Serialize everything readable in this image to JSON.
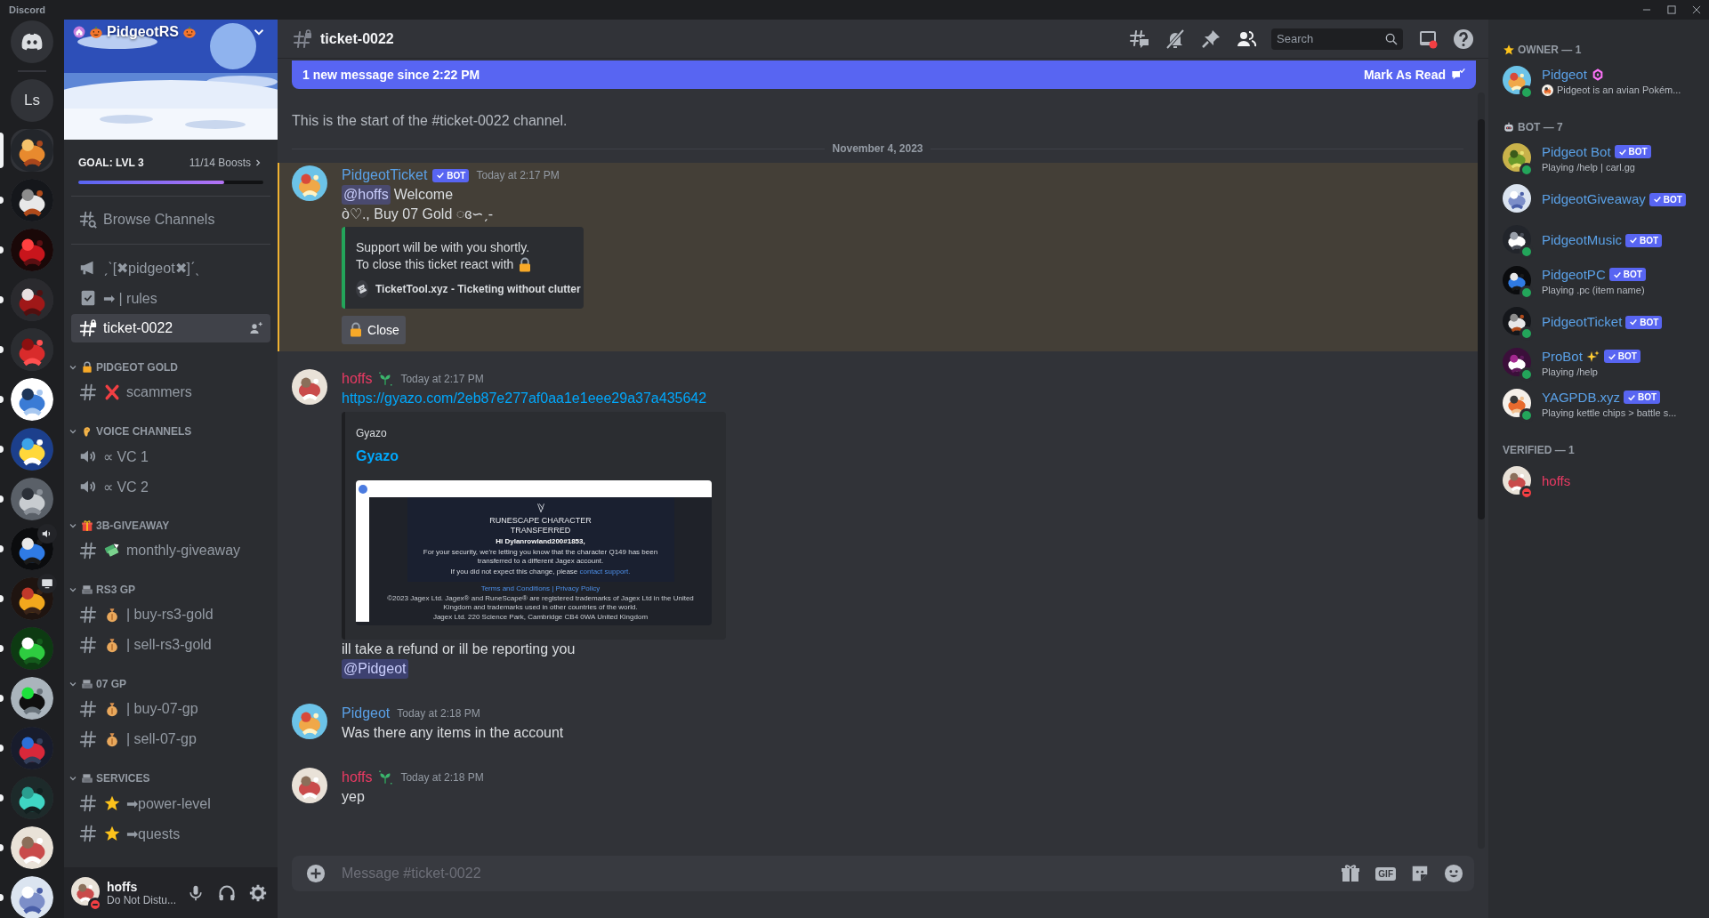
{
  "app": {
    "title": "Discord"
  },
  "servers": [
    {
      "kind": "home",
      "selected": false,
      "unread": false
    },
    {
      "kind": "text",
      "label": "Ls",
      "selected": false,
      "unread": false
    },
    {
      "kind": "picture",
      "selected": true,
      "unread": false
    },
    {
      "kind": "picture",
      "selected": false,
      "unread": true
    },
    {
      "kind": "picture",
      "selected": false,
      "unread": true
    },
    {
      "kind": "picture",
      "selected": false,
      "unread": true
    },
    {
      "kind": "picture",
      "selected": false,
      "unread": true
    },
    {
      "kind": "picture",
      "selected": false,
      "unread": true
    },
    {
      "kind": "picture",
      "selected": false,
      "unread": true
    },
    {
      "kind": "picture",
      "selected": false,
      "unread": true
    },
    {
      "kind": "voice",
      "selected": false,
      "unread": true
    },
    {
      "kind": "screen",
      "selected": false,
      "unread": true
    },
    {
      "kind": "picture",
      "selected": false,
      "unread": true
    },
    {
      "kind": "picture",
      "selected": false,
      "unread": true
    },
    {
      "kind": "picture",
      "selected": false,
      "unread": true
    },
    {
      "kind": "picture",
      "selected": false,
      "unread": true
    },
    {
      "kind": "picture",
      "selected": false,
      "unread": true
    },
    {
      "kind": "picture",
      "selected": false,
      "unread": true
    }
  ],
  "server_header": {
    "name": "PidgeotRS",
    "goal": "GOAL: LVL 3",
    "boosts": "11/14 Boosts",
    "level": 0.79
  },
  "browse": "Browse Channels",
  "channels": [
    {
      "kind": "announcement",
      "name": "ˏˋ[✖pidgeot✖]ˊˎ",
      "selected": false
    },
    {
      "kind": "rules",
      "name": "➡ | rules",
      "selected": false
    },
    {
      "kind": "locked",
      "name": "ticket-0022",
      "selected": true
    }
  ],
  "categories": [
    {
      "name": "PIDGEOT GOLD",
      "kind": "lock",
      "expanded": true,
      "channels": [
        {
          "kind": "cross",
          "name": "scammers",
          "selected": false
        }
      ]
    },
    {
      "name": "VOICE CHANNELS",
      "kind": "ear",
      "expanded": true,
      "channels": [
        {
          "kind": "voice",
          "name": "∝ VC 1",
          "selected": false
        },
        {
          "kind": "voice",
          "name": "∝ VC 2",
          "selected": false
        }
      ]
    },
    {
      "name": "3B-GIVEAWAY",
      "kind": "gift",
      "expanded": true,
      "channels": [
        {
          "kind": "cash",
          "name": "monthly-giveaway",
          "selected": false
        }
      ]
    },
    {
      "name": "RS3 GP",
      "kind": "register",
      "expanded": true,
      "channels": [
        {
          "kind": "moneybag",
          "name": "| buy-rs3-gold",
          "selected": false
        },
        {
          "kind": "moneybag",
          "name": "| sell-rs3-gold",
          "selected": false
        }
      ]
    },
    {
      "name": "07 GP",
      "kind": "register",
      "expanded": true,
      "channels": [
        {
          "kind": "moneybag",
          "name": "| buy-07-gp",
          "selected": false
        },
        {
          "kind": "moneybag",
          "name": "| sell-07-gp",
          "selected": false
        }
      ]
    },
    {
      "name": "SERVICES",
      "kind": "register",
      "expanded": true,
      "channels": [
        {
          "kind": "star",
          "name": "➡power-level",
          "selected": false
        },
        {
          "kind": "star",
          "name": "➡quests",
          "selected": false
        }
      ]
    }
  ],
  "user_panel": {
    "name": "hoffs",
    "status_text": "Do Not Distu...",
    "online": true,
    "do_not_disturb": true
  },
  "channel_header": {
    "name": "ticket-0022",
    "search_placeholder": "Search"
  },
  "new_messages_bar": {
    "text": "1 new message since 2:22 PM",
    "action": "Mark As Read"
  },
  "channel_intro": {
    "subtitle": "This is the start of the #ticket-0022 channel."
  },
  "date_divider": "November 4, 2023",
  "messages": [
    {
      "kind": "bot",
      "author": "PidgeotTicket",
      "color": "#5aa0e6",
      "tag": "BOT",
      "time": "Today at 2:17 PM",
      "mentioned": true,
      "blocks": [
        {
          "kind": "mention_line",
          "mention": "@hoffs",
          "text": "Welcome"
        },
        {
          "kind": "text",
          "text": "ò♡., Buy 07 Gold ◌ɞ∽ˏ-"
        },
        {
          "kind": "embed",
          "color": "#23a55a",
          "lines": [
            "Support will be with you shortly.",
            "To close this ticket react with"
          ],
          "footer": "TicketTool.xyz - Ticketing without clutter"
        },
        {
          "kind": "button",
          "label": "Close"
        }
      ]
    },
    {
      "kind": "verified",
      "author": "hoffs",
      "color": "#ea3a63",
      "time": "Today at 2:17 PM",
      "mentioned": false,
      "blocks": [
        {
          "kind": "link",
          "text": "https://gyazo.com/2eb87e277af0aa1e1eee29a37a435642"
        },
        {
          "kind": "link_embed",
          "provider": "Gyazo",
          "title": "Gyazo",
          "shot": {
            "heading": "RUNESCAPE CHARACTER TRANSFERRED",
            "greeting": "Hi Dylanrowland200#1853,",
            "body": "For your security, we're letting you know that the character Q149 has been transferred to a different Jagex account.",
            "note": "If you did not expect this change, please",
            "note_link": "contact support.",
            "links": "Terms and Conditions | Privacy Policy",
            "legal": "©2023 Jagex Ltd. Jagex® and RuneScape® are registered trademarks of Jagex Ltd in the United Kingdom and trademarks used in other countries of the world.",
            "address": "Jagex Ltd. 220 Science Park, Cambridge CB4 0WA United Kingdom"
          }
        },
        {
          "kind": "text",
          "text": "ill take a refund or ill be reporting you"
        },
        {
          "kind": "mention",
          "text": "@Pidgeot"
        }
      ]
    },
    {
      "kind": "owner",
      "author": "Pidgeot",
      "color": "#5aa0e6",
      "time": "Today at 2:18 PM",
      "mentioned": false,
      "blocks": [
        {
          "kind": "text",
          "text": "Was there any items in the account"
        }
      ]
    },
    {
      "kind": "verified",
      "author": "hoffs",
      "color": "#ea3a63",
      "time": "Today at 2:18 PM",
      "mentioned": false,
      "blocks": [
        {
          "kind": "text",
          "text": "yep"
        }
      ]
    }
  ],
  "composer": {
    "placeholder": "Message #ticket-0022",
    "gif": "GIF"
  },
  "member_groups": [
    {
      "kind": "owner",
      "title": "OWNER — 1",
      "members": [
        {
          "kind": "owner",
          "name": "Pidgeot",
          "color": "#5aa0e6",
          "online": true,
          "do_not_disturb": false,
          "activity": "Pidgeot is an avian Pokém..."
        }
      ]
    },
    {
      "kind": "bots",
      "title": "BOT — 7",
      "members": [
        {
          "kind": "bot",
          "name": "Pidgeot Bot",
          "color": "#5aa0e6",
          "tag": "BOT",
          "online": true,
          "do_not_disturb": false,
          "activity": "Playing /help | carl.gg"
        },
        {
          "kind": "bot",
          "name": "PidgeotGiveaway",
          "color": "#5aa0e6",
          "tag": "BOT",
          "online": false,
          "do_not_disturb": false
        },
        {
          "kind": "bot",
          "name": "PidgeotMusic",
          "color": "#5aa0e6",
          "tag": "BOT",
          "online": true,
          "do_not_disturb": false
        },
        {
          "kind": "bot",
          "name": "PidgeotPC",
          "color": "#5aa0e6",
          "tag": "BOT",
          "online": true,
          "do_not_disturb": false,
          "activity": "Playing .pc (item name)"
        },
        {
          "kind": "bot",
          "name": "PidgeotTicket",
          "color": "#5aa0e6",
          "tag": "BOT",
          "online": true,
          "do_not_disturb": false
        },
        {
          "kind": "sparklebot",
          "name": "ProBot",
          "color": "#5aa0e6",
          "tag": "BOT",
          "online": true,
          "do_not_disturb": false,
          "activity": "Playing /help"
        },
        {
          "kind": "bot",
          "name": "YAGPDB.xyz",
          "color": "#5aa0e6",
          "tag": "BOT",
          "online": true,
          "do_not_disturb": false,
          "activity": "Playing kettle chips > battle s..."
        }
      ]
    },
    {
      "kind": "verified",
      "title": "VERIFIED — 1",
      "members": [
        {
          "kind": "member",
          "name": "hoffs",
          "color": "#ea3a63",
          "online": true,
          "do_not_disturb": true
        }
      ]
    }
  ]
}
